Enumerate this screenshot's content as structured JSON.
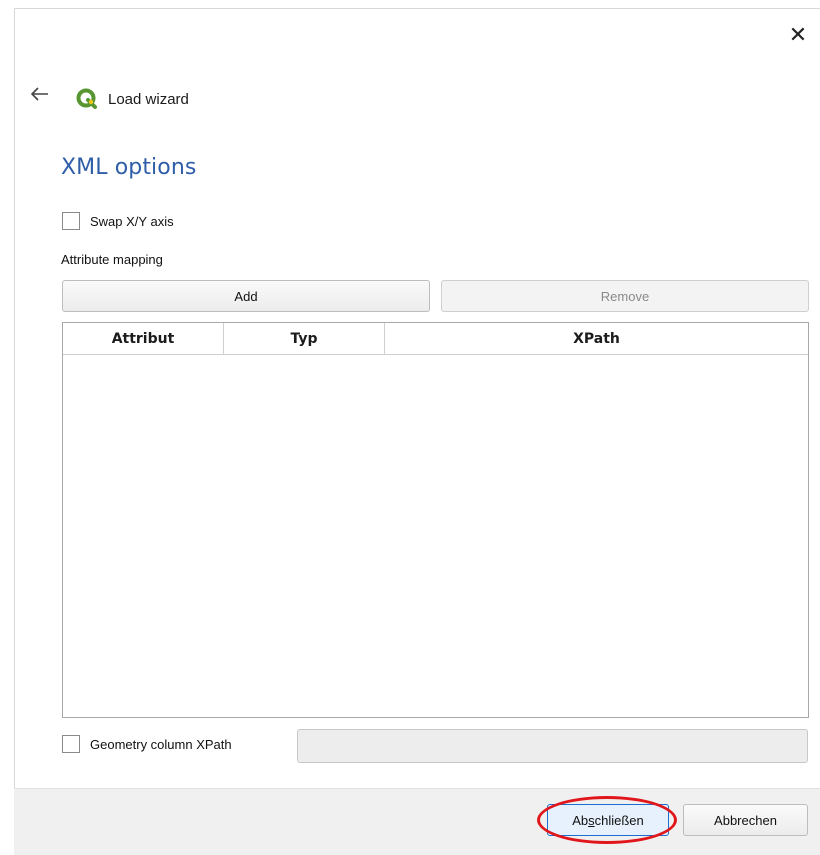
{
  "window": {
    "title": "Load wizard",
    "close_label": "✕",
    "back_label": "←"
  },
  "page": {
    "section_title": "XML options",
    "swap_axis_label": "Swap X/Y axis",
    "swap_axis_checked": false,
    "attribute_mapping_label": "Attribute mapping",
    "add_label": "Add",
    "remove_label": "Remove",
    "table": {
      "columns": [
        "Attribut",
        "Typ",
        "XPath"
      ],
      "rows": []
    },
    "geometry_label": "Geometry column XPath",
    "geometry_checked": false,
    "geometry_value": ""
  },
  "footer": {
    "finish_label_prefix": "Ab",
    "finish_label_mnemonic": "s",
    "finish_label_suffix": "chließen",
    "cancel_label": "Abbrechen"
  },
  "colors": {
    "accent_title": "#2f5ea8",
    "highlight_ellipse": "#e0161b",
    "qgis_green": "#589632",
    "qgis_yellow": "#f0c419"
  },
  "icons": {
    "back": "arrow-left-icon",
    "close": "close-icon",
    "logo": "qgis-logo-icon"
  }
}
